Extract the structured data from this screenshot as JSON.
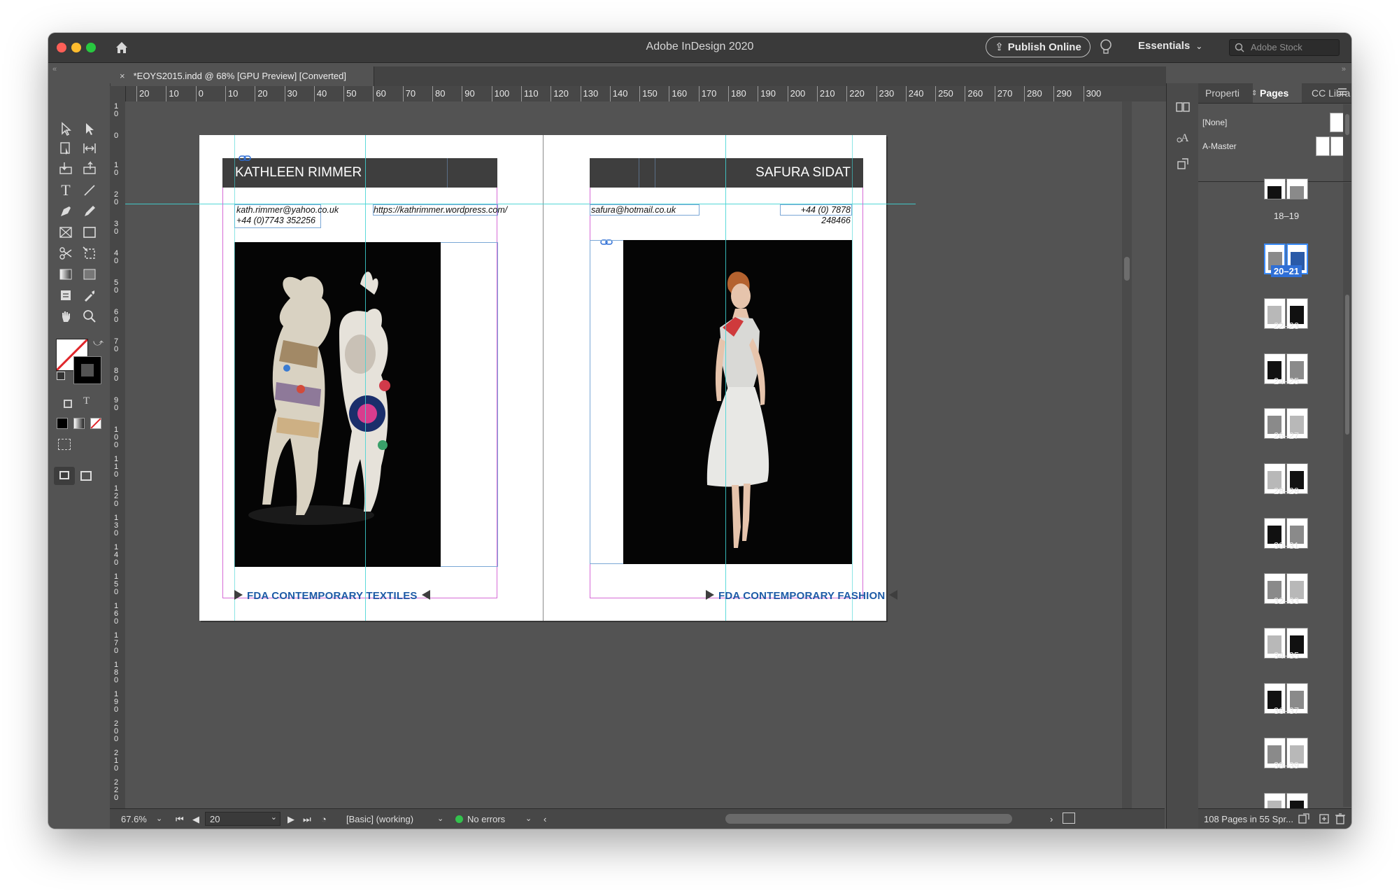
{
  "app": {
    "title": "Adobe InDesign 2020",
    "publish_label": "Publish Online",
    "workspace_label": "Essentials",
    "stock_placeholder": "Adobe Stock"
  },
  "document_tab": {
    "title": "*EOYS2015.indd @ 68% [GPU Preview] [Converted]"
  },
  "rulers": {
    "top_labels": [
      "20",
      "10",
      "0",
      "10",
      "20",
      "30",
      "40",
      "50",
      "60",
      "70",
      "80",
      "90",
      "100",
      "110",
      "120",
      "130",
      "140",
      "150",
      "160",
      "170",
      "180",
      "190",
      "200",
      "210",
      "220",
      "230",
      "240",
      "250",
      "260",
      "270",
      "280",
      "290",
      "300"
    ],
    "left_labels": [
      "10",
      "0",
      "10",
      "20",
      "30",
      "40",
      "50",
      "60",
      "70",
      "80",
      "90",
      "100",
      "110",
      "120",
      "130",
      "140",
      "150",
      "160",
      "170",
      "180",
      "190",
      "200",
      "210",
      "220"
    ]
  },
  "spread": {
    "left_page": {
      "name_header": "KATHLEEN RIMMER",
      "email_line1": "kath.rimmer@yahoo.co.uk",
      "email_line2": "+44 (0)7743 352256",
      "website": "https://kathrimmer.wordpress.com/",
      "footer": "FDA CONTEMPORARY TEXTILES"
    },
    "right_page": {
      "name_header": "SAFURA SIDAT",
      "email": "safura@hotmail.co.uk",
      "phone": "+44 (0) 7878 248466",
      "footer": "FDA CONTEMPORARY FASHION"
    }
  },
  "statusbar": {
    "zoom": "67.6%",
    "page": "20",
    "style": "[Basic] (working)",
    "errors": "No errors"
  },
  "panel": {
    "tabs": [
      "Properti",
      "Pages",
      "CC Libra"
    ],
    "active_tab": "Pages",
    "masters": [
      "[None]",
      "A-Master"
    ],
    "spreads": [
      "18–19",
      "20–21",
      "22–23",
      "24–25",
      "26–27",
      "28–29",
      "30–31",
      "32–33",
      "34–35",
      "36–37",
      "38–39",
      "40–41"
    ],
    "selected_spread": "20–21",
    "footer": "108 Pages in 55 Spr..."
  },
  "colors": {
    "accent_blue": "#2f6fd6",
    "footer_blue": "#1d5ba6",
    "guide_cyan": "#3fd3d3",
    "margin_magenta": "#d66ad6",
    "status_green": "#33c24d"
  }
}
